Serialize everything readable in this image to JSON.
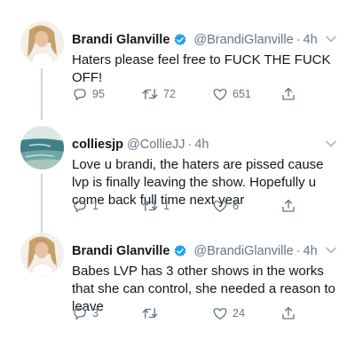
{
  "tweets": [
    {
      "name": "Brandi Glanville",
      "handle": "@BrandiGlanville",
      "dot": "·",
      "time": "4h",
      "verified": true,
      "avatar_icon": "woman-portrait-avatar",
      "text": "Haters please feel free to FUCK THE FUCK OFF!",
      "replies": "95",
      "retweets": "72",
      "likes": "651"
    },
    {
      "name": "colliesjp",
      "handle": "@CollieJJ",
      "dot": "·",
      "time": "4h",
      "verified": false,
      "avatar_icon": "ocean-landscape-avatar",
      "text": "Love u brandi, the haters are pissed cause lvp is finally leaving the show. Hopefully u come back full time next year",
      "replies": "1",
      "retweets": "1",
      "likes": "6"
    },
    {
      "name": "Brandi Glanville",
      "handle": "@BrandiGlanville",
      "dot": "·",
      "time": "4h",
      "verified": true,
      "avatar_icon": "woman-portrait-avatar",
      "text": "Babes LVP has 3 other shows in the works that she can control, she needed a reason to leave",
      "replies": "3",
      "retweets": "",
      "likes": "24"
    }
  ],
  "colors": {
    "verified": "#1da1f2",
    "muted": "#657786",
    "text": "#14171a",
    "thread_line": "#ccd6dd"
  }
}
